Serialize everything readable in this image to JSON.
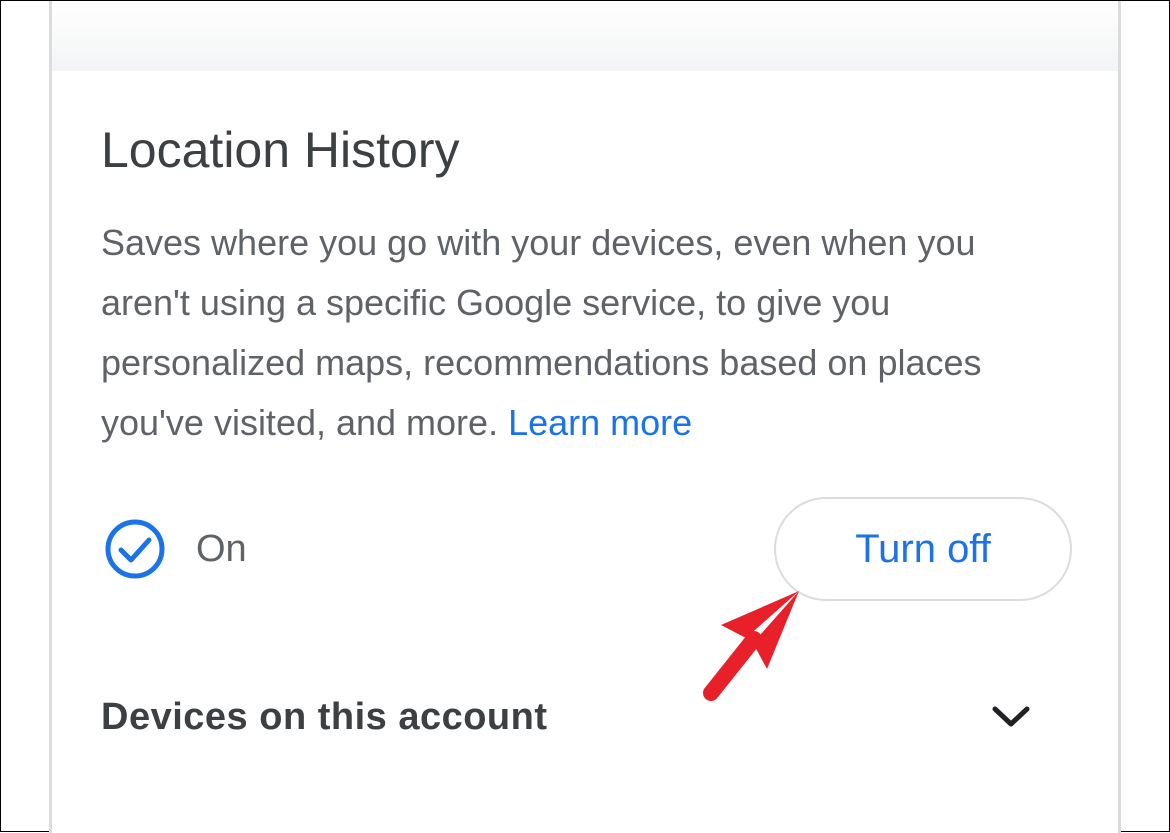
{
  "section": {
    "title": "Location History",
    "description": "Saves where you go with your devices, even when you aren't using a specific Google service, to give you personalized maps, recommendations based on places you've visited, and more.",
    "learn_more_label": "Learn more"
  },
  "status": {
    "label": "On",
    "icon": "check-circle-icon",
    "color": "#1a73e8"
  },
  "turn_off_button": {
    "label": "Turn off"
  },
  "devices": {
    "label": "Devices on this account",
    "icon": "chevron-down-icon"
  },
  "annotation": {
    "icon": "red-arrow-icon",
    "color": "#e8202a"
  },
  "colors": {
    "accent": "#1a73e8",
    "title_text": "#3c4043",
    "body_text": "#5f6368",
    "border": "#dadce0"
  }
}
